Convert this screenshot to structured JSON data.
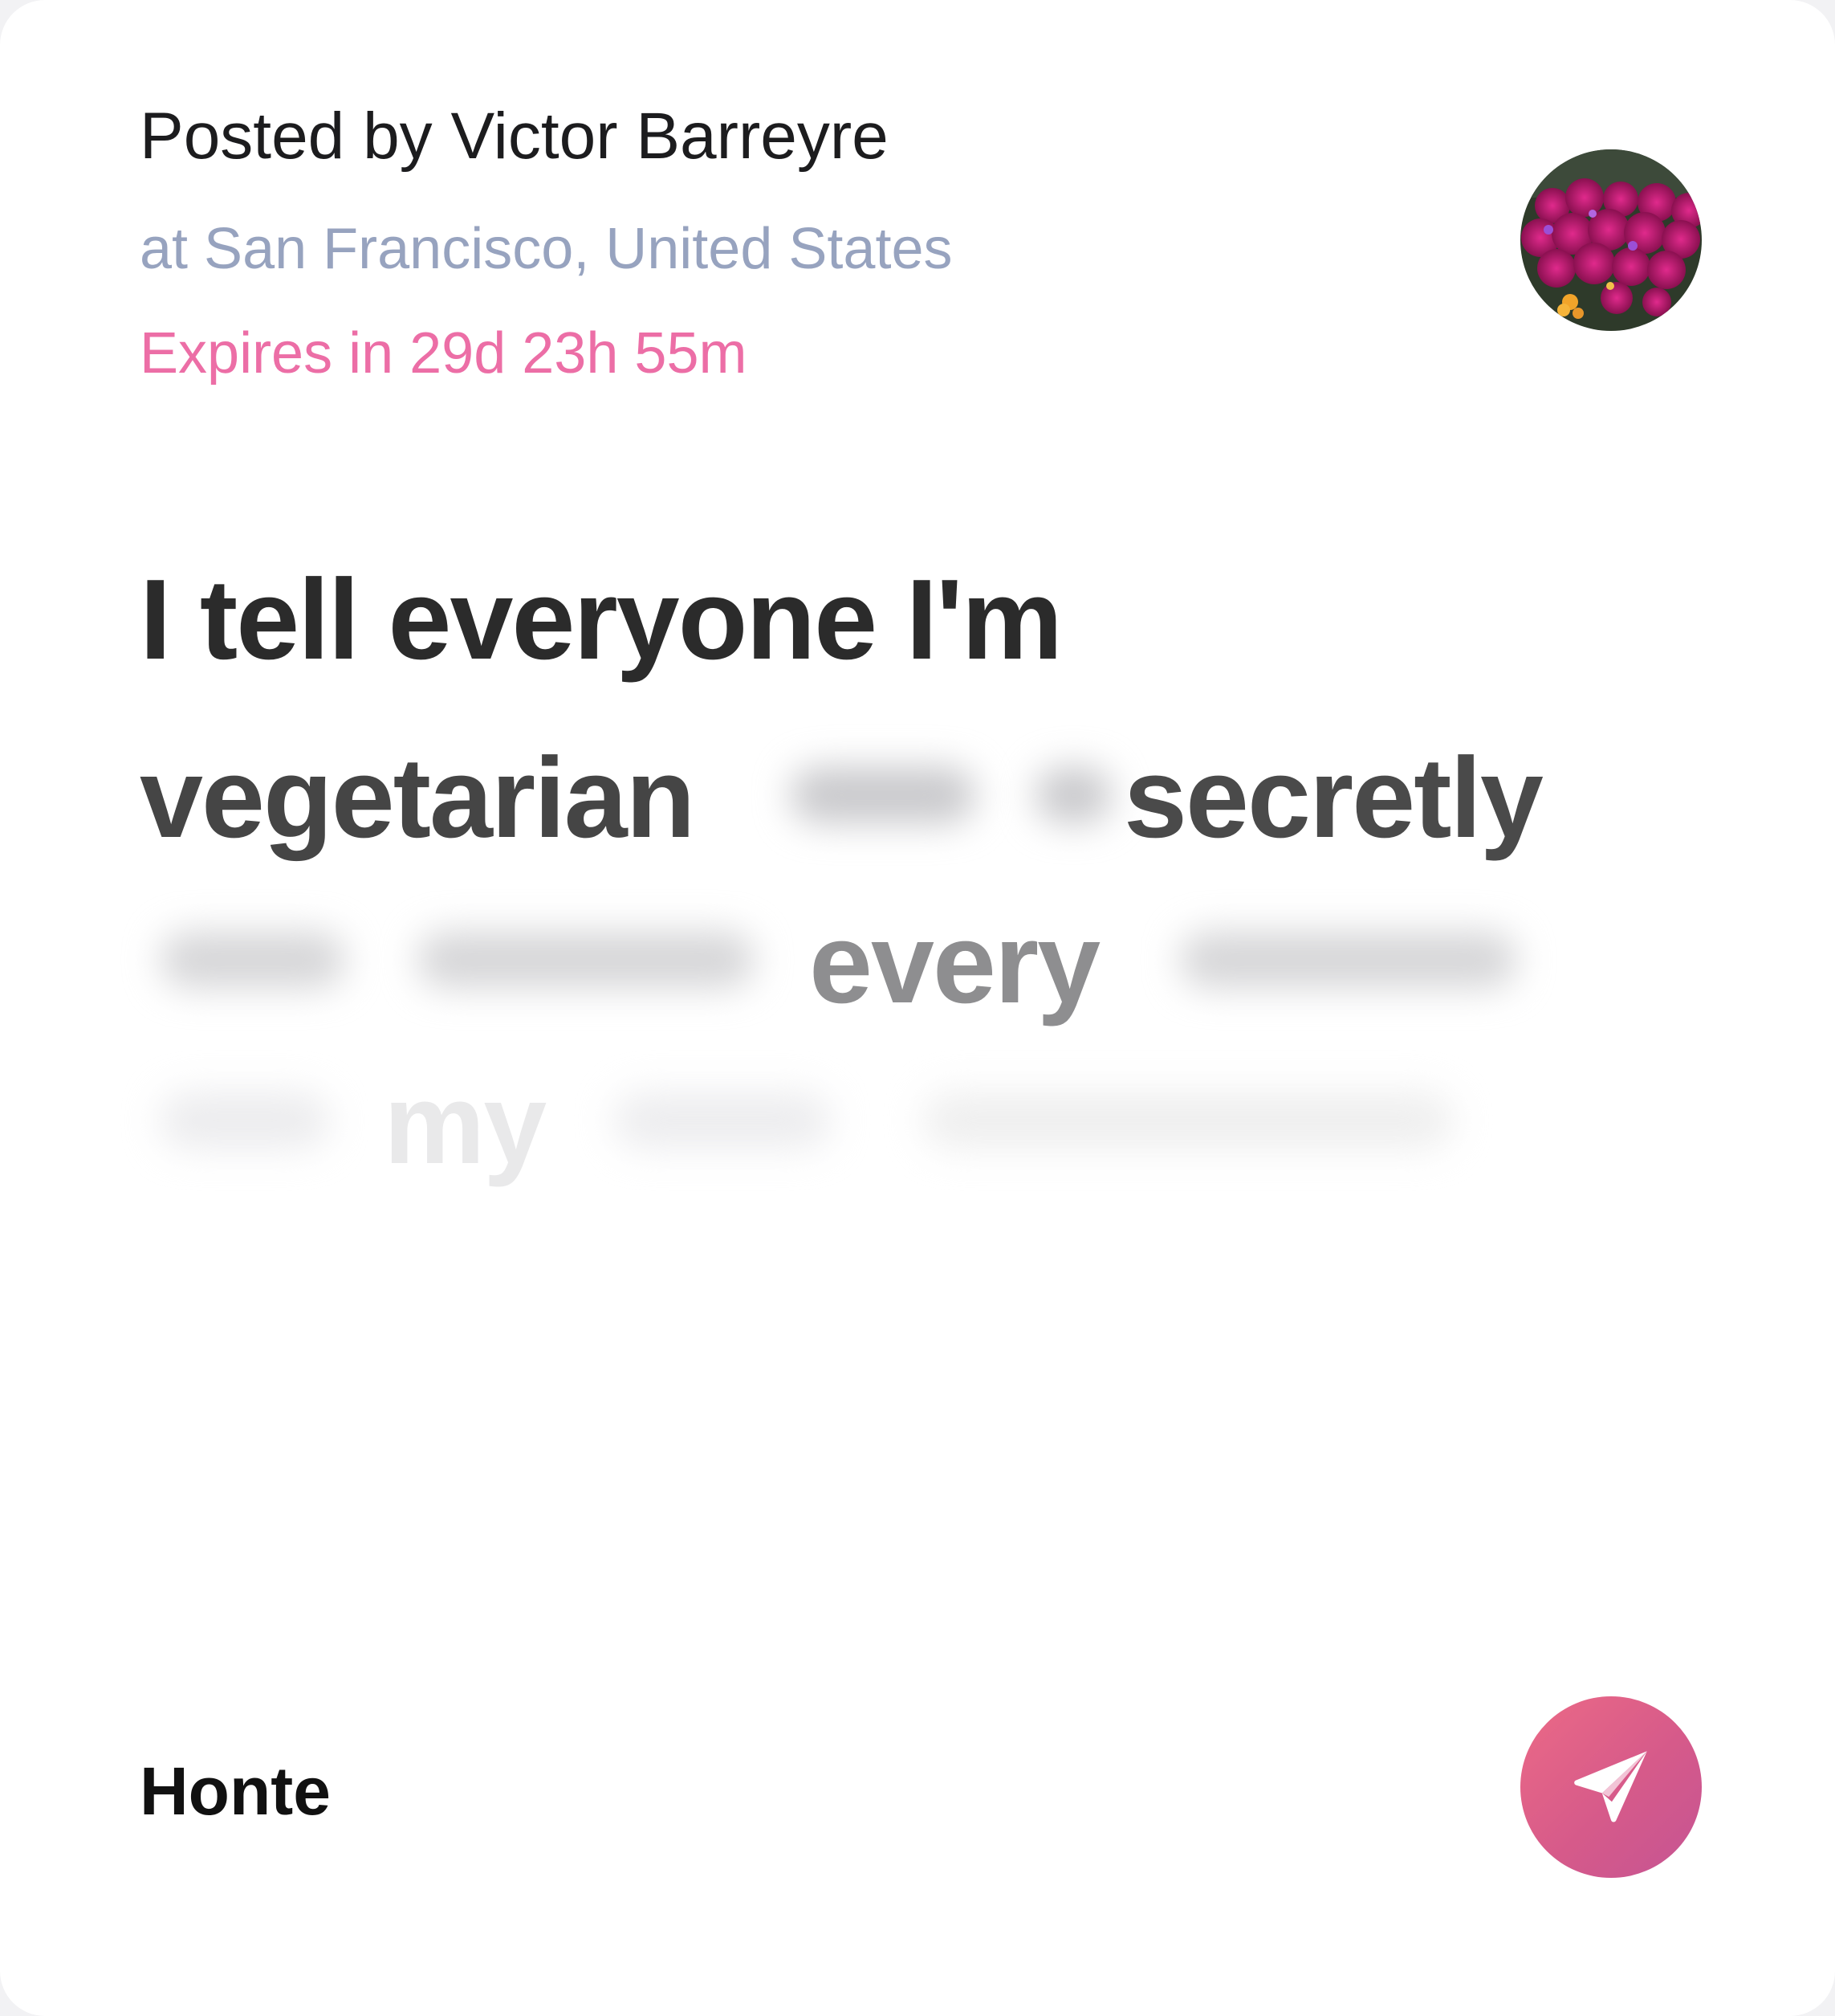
{
  "post": {
    "posted_by": "Posted by Victor Barreyre",
    "location": "at San Francisco, United States",
    "expires": "Expires in 29d 23h 55m",
    "avatar": "flower-avatar"
  },
  "message": {
    "visible_words": [
      "I tell everyone I'm",
      "vegetarian",
      "secretly",
      "every",
      "my"
    ]
  },
  "footer": {
    "label": "Honte",
    "send_icon": "paper-plane-icon"
  },
  "colors": {
    "location": "#97a3bf",
    "expires": "#ec6ea6",
    "send_gradient_start": "#ec6a86",
    "send_gradient_end": "#c55493"
  }
}
